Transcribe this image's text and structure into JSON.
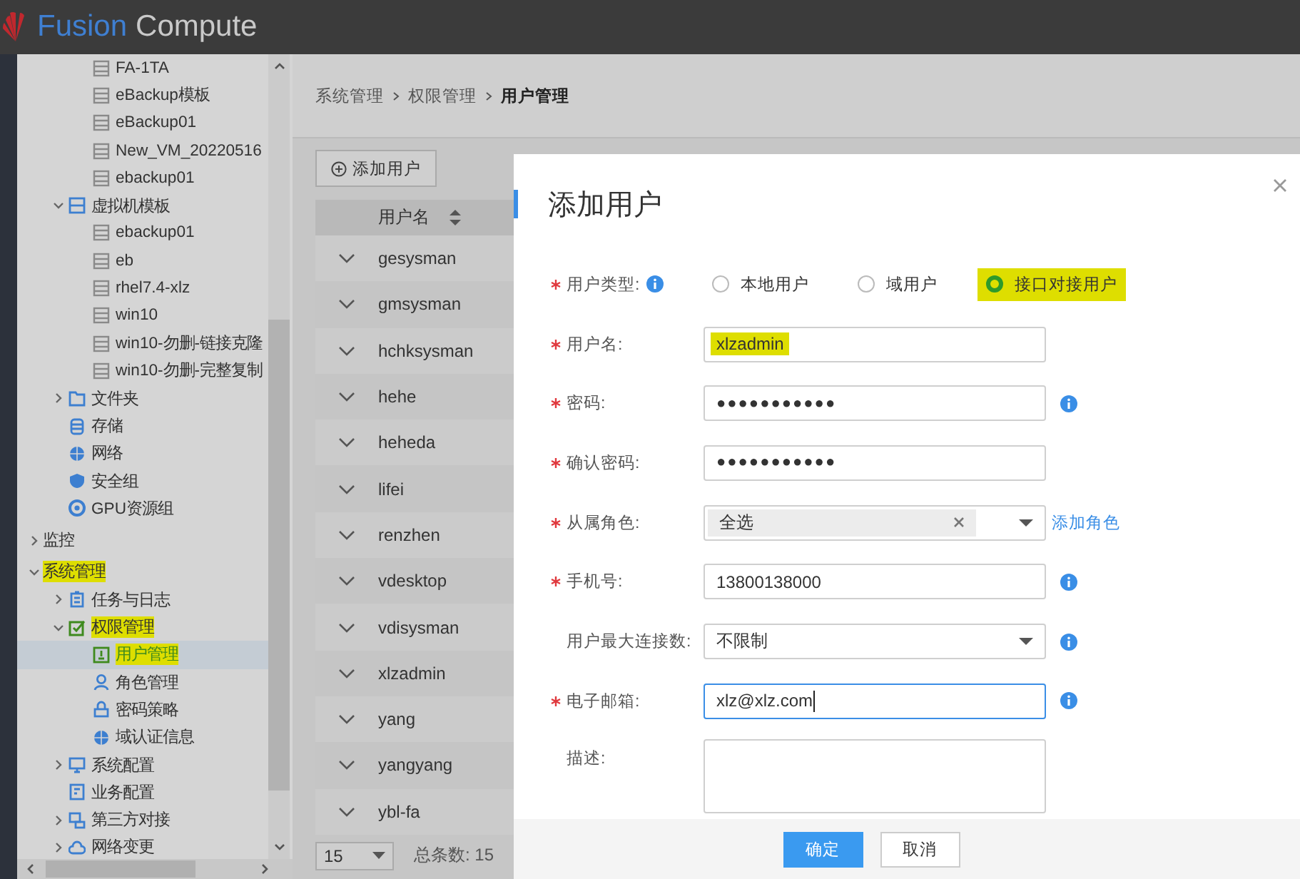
{
  "header": {
    "logo_word_1": "Fusion",
    "logo_word_2": "Compute"
  },
  "sidebar": {
    "vm_items": [
      {
        "label": "FA-1TA",
        "kind": "vm",
        "selected": false,
        "highlighted": false
      },
      {
        "label": "eBackup模板",
        "kind": "vm",
        "selected": false,
        "highlighted": false
      },
      {
        "label": "eBackup01",
        "kind": "vm",
        "selected": false,
        "highlighted": false
      },
      {
        "label": "New_VM_20220516",
        "kind": "vm",
        "selected": false,
        "highlighted": false
      },
      {
        "label": "ebackup01",
        "kind": "vm",
        "selected": false,
        "highlighted": false
      }
    ],
    "resource_items": [
      {
        "label": "虚拟机模板",
        "kind": "template-group",
        "expanded": true,
        "selected": false,
        "highlighted": false,
        "children": [
          {
            "label": "ebackup01",
            "kind": "template",
            "selected": false,
            "highlighted": false
          },
          {
            "label": "eb",
            "kind": "template",
            "selected": false,
            "highlighted": false
          },
          {
            "label": "rhel7.4-xlz",
            "kind": "template",
            "selected": false,
            "highlighted": false
          },
          {
            "label": "win10",
            "kind": "template",
            "selected": false,
            "highlighted": false
          },
          {
            "label": "win10-勿删-链接克隆",
            "kind": "template",
            "selected": false,
            "highlighted": false
          },
          {
            "label": "win10-勿删-完整复制",
            "kind": "template",
            "selected": false,
            "highlighted": false
          }
        ]
      },
      {
        "label": "文件夹",
        "kind": "folder",
        "expanded": false,
        "selected": false,
        "highlighted": false
      },
      {
        "label": "存储",
        "kind": "storage",
        "selected": false,
        "highlighted": false
      },
      {
        "label": "网络",
        "kind": "network",
        "selected": false,
        "highlighted": false
      },
      {
        "label": "安全组",
        "kind": "security",
        "selected": false,
        "highlighted": false
      },
      {
        "label": "GPU资源组",
        "kind": "gpu",
        "selected": false,
        "highlighted": false
      }
    ],
    "sections": [
      {
        "label": "监控",
        "expanded": false,
        "selected": false,
        "highlighted": false
      },
      {
        "label": "系统管理",
        "expanded": true,
        "selected": false,
        "highlighted": true,
        "children": [
          {
            "label": "任务与日志",
            "kind": "task",
            "expanded": false,
            "selected": false,
            "highlighted": false
          },
          {
            "label": "权限管理",
            "kind": "permission",
            "expanded": true,
            "selected": false,
            "highlighted": true,
            "children": [
              {
                "label": "用户管理",
                "kind": "user",
                "selected": true,
                "highlighted": true
              },
              {
                "label": "角色管理",
                "kind": "role",
                "selected": false,
                "highlighted": false
              },
              {
                "label": "密码策略",
                "kind": "password",
                "selected": false,
                "highlighted": false
              },
              {
                "label": "域认证信息",
                "kind": "domain",
                "selected": false,
                "highlighted": false
              }
            ]
          },
          {
            "label": "系统配置",
            "kind": "config",
            "expanded": false,
            "selected": false,
            "highlighted": false
          },
          {
            "label": "业务配置",
            "kind": "business",
            "selected": false,
            "highlighted": false
          },
          {
            "label": "第三方对接",
            "kind": "thirdparty",
            "expanded": false,
            "selected": false,
            "highlighted": false
          },
          {
            "label": "网络变更",
            "kind": "netchange",
            "expanded": false,
            "selected": false,
            "highlighted": false
          }
        ]
      }
    ]
  },
  "breadcrumb": [
    "系统管理",
    "权限管理",
    "用户管理"
  ],
  "add_button": "添加用户",
  "table": {
    "columns": [
      {
        "label": "用户名",
        "sortable": true
      }
    ],
    "rows": [
      "gesysman",
      "gmsysman",
      "hchksysman",
      "hehe",
      "heheda",
      "lifei",
      "renzhen",
      "vdesktop",
      "vdisysman",
      "xlzadmin",
      "yang",
      "yangyang",
      "ybl-fa"
    ]
  },
  "pagination": {
    "page_size": "15",
    "total": "总条数: 15"
  },
  "dialog": {
    "title": "添加用户",
    "fields": [
      {
        "kind": "radio",
        "label": "用户类型:",
        "required": true,
        "info_after_label": true,
        "options": [
          {
            "label": "本地用户",
            "selected": false,
            "highlighted": false
          },
          {
            "label": "域用户",
            "selected": false,
            "highlighted": false
          },
          {
            "label": "接口对接用户",
            "selected": true,
            "highlighted": true
          }
        ]
      },
      {
        "kind": "text",
        "label": "用户名:",
        "required": true,
        "value": "xlzadmin",
        "highlighted": true,
        "focused": false,
        "info": false
      },
      {
        "kind": "text",
        "label": "密码:",
        "required": true,
        "value": "●●●●●●●●●●●",
        "highlighted": false,
        "focused": false,
        "info": true
      },
      {
        "kind": "text",
        "label": "确认密码:",
        "required": true,
        "value": "●●●●●●●●●●●",
        "highlighted": false,
        "focused": false,
        "info": false
      },
      {
        "kind": "multiselect",
        "label": "从属角色:",
        "required": true,
        "tag": "全选",
        "link": "添加角色"
      },
      {
        "kind": "text",
        "label": "手机号:",
        "required": true,
        "value": "13800138000",
        "highlighted": false,
        "focused": false,
        "info": true
      },
      {
        "kind": "select",
        "label": "用户最大连接数:",
        "required": false,
        "value": "不限制",
        "info": true
      },
      {
        "kind": "text",
        "label": "电子邮箱:",
        "required": true,
        "value": "xlz@xlz.com",
        "highlighted": false,
        "focused": true,
        "info": true
      },
      {
        "kind": "textarea",
        "label": "描述:",
        "required": false
      }
    ],
    "buttons": [
      {
        "label": "确定",
        "primary": true
      },
      {
        "label": "取消",
        "primary": false
      }
    ]
  }
}
